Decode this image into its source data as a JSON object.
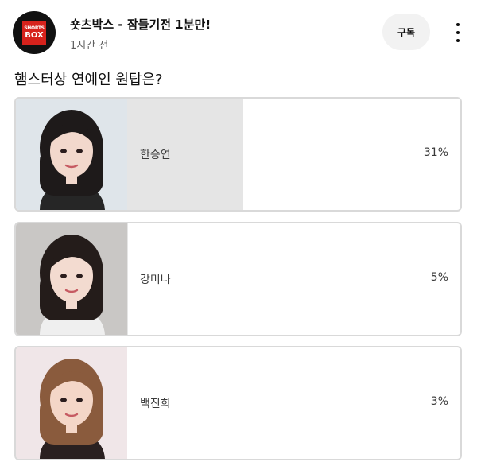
{
  "header": {
    "channel_name": "숏츠박스 - 잠들기전 1분만!",
    "time_ago": "1시간 전",
    "subscribe_label": "구독",
    "avatar_logo_line1": "SHORTS",
    "avatar_logo_line2": "BOX"
  },
  "poll": {
    "question": "햄스터상 연예인 원탑은?",
    "options": [
      {
        "label": "한승연",
        "percent_text": "31%",
        "percent": 31,
        "photo_bg": "#dfe5ea",
        "hair": "#1e1a1a",
        "skin": "#f2d8cc",
        "top": "#262626"
      },
      {
        "label": "강미나",
        "percent_text": "5%",
        "percent": 5,
        "photo_bg": "#c9c7c5",
        "hair": "#241c1a",
        "skin": "#f3dbd0",
        "top": "#efefef"
      },
      {
        "label": "백진희",
        "percent_text": "3%",
        "percent": 3,
        "photo_bg": "#f0e6e8",
        "hair": "#8a5b3d",
        "skin": "#f4d6c7",
        "top": "#2a2020"
      }
    ]
  },
  "colors": {
    "bar_fill": "#e5e5e5",
    "option_border": "#d9d9d9",
    "subscribe_bg": "#f2f2f2",
    "logo_red": "#d6221c"
  }
}
